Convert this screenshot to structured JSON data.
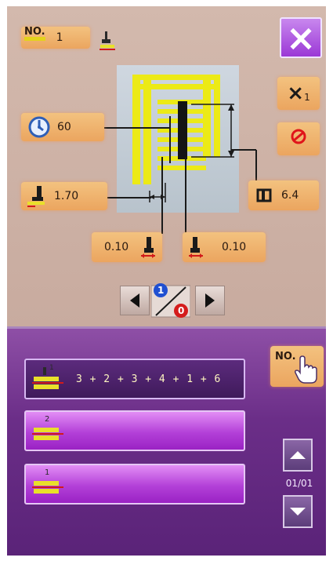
{
  "header": {
    "no_label": "NO.",
    "no_value": "1"
  },
  "controls": {
    "close_label": "×",
    "x1_label": "×",
    "x1_sub": "1"
  },
  "params": {
    "speed": "60",
    "feed": "1.70",
    "width": "6.4",
    "left_offset": "0.10",
    "right_offset": "0.10"
  },
  "toggle": {
    "top_digit": "1",
    "bottom_digit": "0"
  },
  "sequence": {
    "label": "1",
    "steps": "3 + 2 + 3 + 4 + 1 + 6"
  },
  "patterns": [
    {
      "label": "2"
    },
    {
      "label": "1"
    }
  ],
  "no_button": {
    "label": "NO."
  },
  "pager": {
    "label": "01/01"
  },
  "colors": {
    "accent_orange": "#eba55f",
    "purple_bg": "#6b2e88",
    "stitch_yellow": "#f4f000",
    "close_purple": "#b44fe0"
  }
}
